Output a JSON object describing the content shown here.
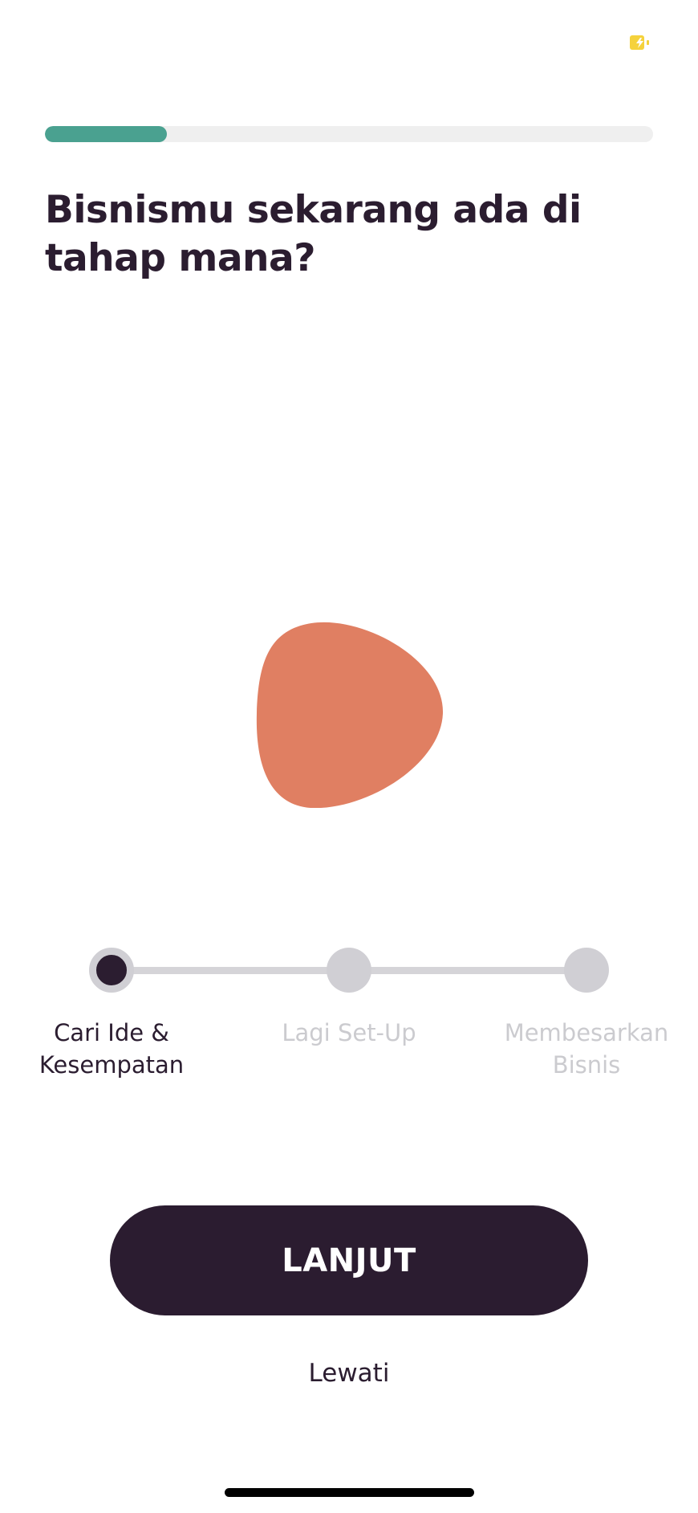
{
  "status_bar": {
    "battery_icon": "battery-charging-icon",
    "battery_color": "#f5d23c"
  },
  "onboarding": {
    "progress": 0.2,
    "progress_color": "#4aa190",
    "title": "Bisnismu sekarang ada di tahap mana?",
    "illustration": {
      "icon": "stage-blob-illustration",
      "color": "#e07f62"
    },
    "stages": [
      {
        "label": "Cari Ide & Kesempatan",
        "active": true
      },
      {
        "label": "Lagi Set-Up",
        "active": false
      },
      {
        "label": "Membesarkan Bisnis",
        "active": false
      }
    ],
    "continue_label": "LANJUT",
    "skip_label": "Lewati"
  },
  "colors": {
    "primary": "#2b1c30",
    "inactive": "#d0cfd4",
    "inactive_text": "#cbcbcf"
  }
}
